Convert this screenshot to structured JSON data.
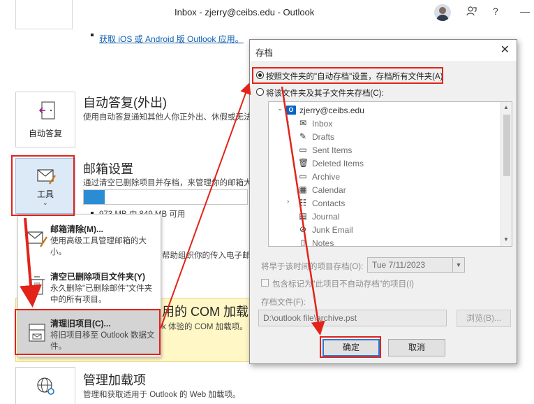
{
  "window": {
    "title": "Inbox - zjerry@ceibs.edu  -  Outlook",
    "people_icon": "people-icon",
    "help_label": "?",
    "minimize_label": "—"
  },
  "backstage": {
    "mobile_link": "获取 iOS 或 Android 版 Outlook 应用。",
    "auto_reply": {
      "button_label": "自动答复",
      "title": "自动答复(外出)",
      "desc": "使用自动答复通知其他人你正外出、休假或无法"
    },
    "mailbox": {
      "button_label": "工具",
      "title": "邮箱设置",
      "desc": "通过清空已删除项目并存档，来管理你的邮箱大",
      "quota_text": "973 MB 中 849 MB 可用",
      "quota_used_fraction": 0.13,
      "rules_desc": "帮助组织你的传入电子邮件"
    },
    "com_addins": {
      "title": "用的 COM 加载",
      "desc": "k 体验的 COM 加载项。"
    },
    "manage_addins": {
      "title": "管理加载项",
      "desc": "管理和获取适用于 Outlook 的 Web 加载项。"
    }
  },
  "tools_menu": {
    "items": [
      {
        "title": "邮箱清除(M)...",
        "desc": "使用高级工具管理邮箱的大小。",
        "icon": "mailbox-cleanup-icon"
      },
      {
        "title": "清空已删除项目文件夹(Y)",
        "desc": "永久删除\"已删除邮件\"文件夹中的所有项目。",
        "icon": "trash-icon"
      },
      {
        "title": "清理旧项目(C)...",
        "desc": "将旧项目移至 Outlook 数据文件。",
        "icon": "archive-icon"
      }
    ]
  },
  "dialog": {
    "title": "存档",
    "radio_auto": "按照文件夹的\"自动存档\"设置，存档所有文件夹(A)",
    "radio_folder": "将该文件夹及其子文件夹存档(C):",
    "tree": {
      "root": "zjerry@ceibs.edu",
      "folders": [
        {
          "label": "Inbox",
          "icon": "inbox-icon",
          "expandable": true
        },
        {
          "label": "Drafts",
          "icon": "drafts-icon",
          "expandable": false
        },
        {
          "label": "Sent Items",
          "icon": "folder-icon",
          "expandable": false
        },
        {
          "label": "Deleted Items",
          "icon": "trash-icon",
          "expandable": false
        },
        {
          "label": "Archive",
          "icon": "folder-icon",
          "expandable": false
        },
        {
          "label": "Calendar",
          "icon": "calendar-icon",
          "expandable": false
        },
        {
          "label": "Contacts",
          "icon": "contacts-icon",
          "expandable": true
        },
        {
          "label": "Journal",
          "icon": "journal-icon",
          "expandable": false
        },
        {
          "label": "Junk Email",
          "icon": "junk-icon",
          "expandable": false
        },
        {
          "label": "Notes",
          "icon": "notes-icon",
          "expandable": false
        }
      ]
    },
    "older_than_label": "将早于该时间的项目存档(O):",
    "older_than_value": "Tue 7/11/2023",
    "include_label": "包含标记为\"此项目不自动存档\"的项目(I)",
    "archive_file_label": "存档文件(F):",
    "archive_file_value": "D:\\outlook file\\archive.pst",
    "browse_label": "浏览(B)...",
    "ok_label": "确定",
    "cancel_label": "取消"
  },
  "annotation_color": "#e2231a"
}
